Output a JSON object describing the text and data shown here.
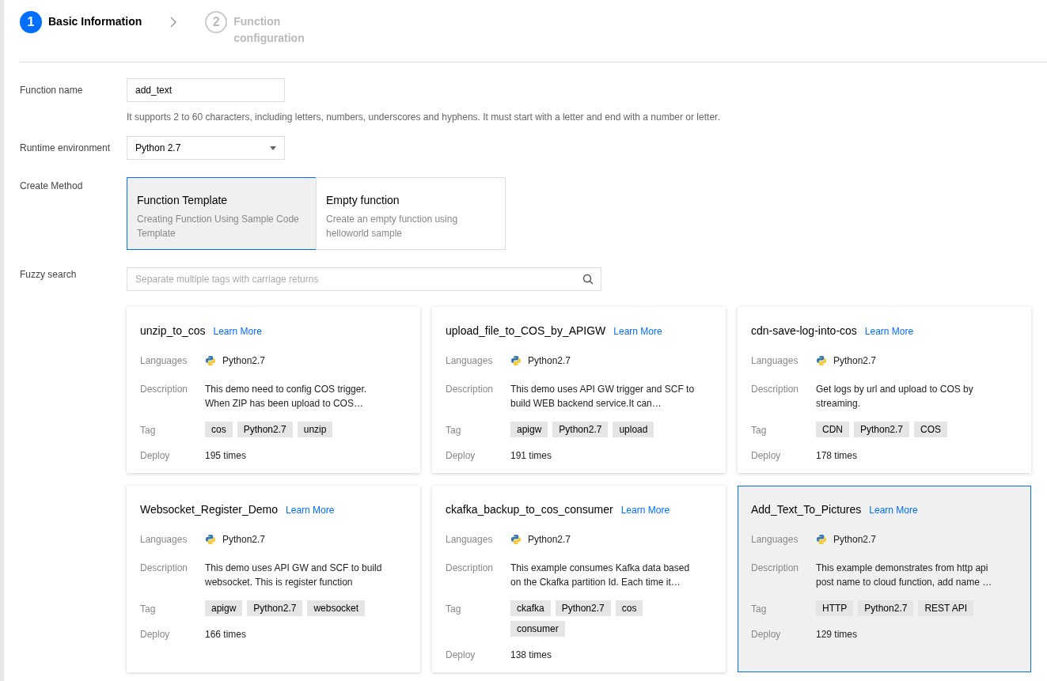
{
  "steps": [
    {
      "number": "1",
      "label": "Basic Information",
      "active": true
    },
    {
      "number": "2",
      "label": "Function configuration",
      "active": false
    }
  ],
  "function_name": {
    "label": "Function name",
    "value": "add_text",
    "help": "It supports 2 to 60 characters, including letters, numbers, underscores and hyphens. It must start with a letter and end with a number or letter."
  },
  "runtime": {
    "label": "Runtime environment",
    "value": "Python 2.7"
  },
  "create_method": {
    "label": "Create Method",
    "options": [
      {
        "title": "Function Template",
        "description": "Creating Function Using Sample Code Template",
        "selected": true
      },
      {
        "title": "Empty function",
        "description": "Create an empty function using helloworld sample",
        "selected": false
      }
    ]
  },
  "fuzzy_search": {
    "label": "Fuzzy search",
    "placeholder": "Separate multiple tags with carriage returns"
  },
  "templates": [
    {
      "name": "unzip_to_cos",
      "link": "Learn More",
      "language_label": "Languages",
      "language": "Python2.7",
      "description_label": "Description",
      "description": "This demo need to config COS trigger. When ZIP has been upload to COS…",
      "tag_label": "Tag",
      "tags": [
        "cos",
        "Python2.7",
        "unzip"
      ],
      "deploy_label": "Deploy",
      "deploy": "195 times",
      "selected": false
    },
    {
      "name": "upload_file_to_COS_by_APIGW",
      "link": "Learn More",
      "language_label": "Languages",
      "language": "Python2.7",
      "description_label": "Description",
      "description": "This demo uses API GW trigger and SCF to build WEB backend service.It can…",
      "tag_label": "Tag",
      "tags": [
        "apigw",
        "Python2.7",
        "upload"
      ],
      "deploy_label": "Deploy",
      "deploy": "191 times",
      "selected": false
    },
    {
      "name": "cdn-save-log-into-cos",
      "link": "Learn More",
      "language_label": "Languages",
      "language": "Python2.7",
      "description_label": "Description",
      "description": "Get logs by url and upload to COS by streaming.",
      "tag_label": "Tag",
      "tags": [
        "CDN",
        "Python2.7",
        "COS"
      ],
      "deploy_label": "Deploy",
      "deploy": "178 times",
      "selected": false
    },
    {
      "name": "Websocket_Register_Demo",
      "link": "Learn More",
      "language_label": "Languages",
      "language": "Python2.7",
      "description_label": "Description",
      "description": "This demo uses API GW and SCF to build websocket. This is register function",
      "tag_label": "Tag",
      "tags": [
        "apigw",
        "Python2.7",
        "websocket"
      ],
      "deploy_label": "Deploy",
      "deploy": "166 times",
      "selected": false
    },
    {
      "name": "ckafka_backup_to_cos_consumer",
      "link": "Learn More",
      "language_label": "Languages",
      "language": "Python2.7",
      "description_label": "Description",
      "description": "This example consumes Kafka data based on the Ckafka partition Id. Each time it…",
      "tag_label": "Tag",
      "tags": [
        "ckafka",
        "Python2.7",
        "cos",
        "consumer"
      ],
      "deploy_label": "Deploy",
      "deploy": "138 times",
      "selected": false
    },
    {
      "name": "Add_Text_To_Pictures",
      "link": "Learn More",
      "language_label": "Languages",
      "language": "Python2.7",
      "description_label": "Description",
      "description": "This example demonstrates from http api post name to cloud function, add name …",
      "tag_label": "Tag",
      "tags": [
        "HTTP",
        "Python2.7",
        "REST API"
      ],
      "deploy_label": "Deploy",
      "deploy": "129 times",
      "selected": true
    }
  ]
}
